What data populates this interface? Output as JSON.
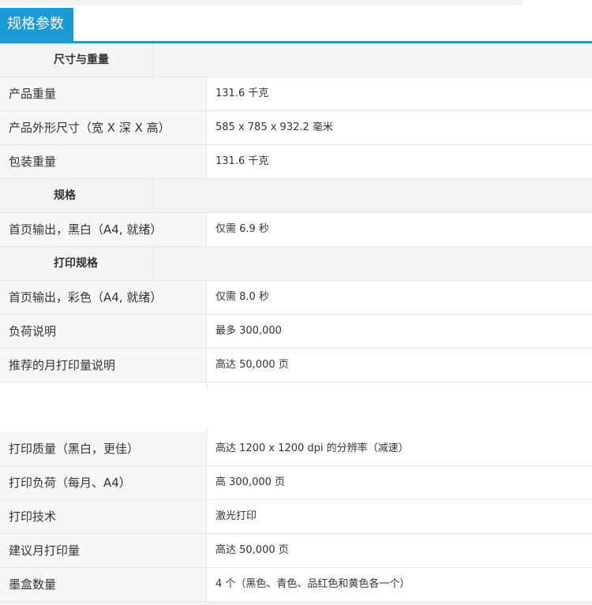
{
  "header": {
    "tab_title": "规格参数"
  },
  "sections_top": [
    {
      "kind": "section",
      "label": "尺寸与重量"
    },
    {
      "kind": "row",
      "label": "产品重量",
      "value": "131.6 千克"
    },
    {
      "kind": "row",
      "label": "产品外形尺寸（宽 X 深 X 高）",
      "value": "585 x 785 x 932.2 毫米"
    },
    {
      "kind": "row",
      "label": "包装重量",
      "value": "131.6 千克"
    },
    {
      "kind": "section",
      "label": "规格"
    },
    {
      "kind": "row",
      "label": "首页输出，黑白（A4, 就绪）",
      "value": "仅需 6.9 秒"
    },
    {
      "kind": "section",
      "label": "打印规格"
    },
    {
      "kind": "row",
      "label": "首页输出，彩色（A4, 就绪）",
      "value": "仅需 8.0 秒"
    },
    {
      "kind": "row",
      "label": "负荷说明",
      "value": "最多 300,000"
    },
    {
      "kind": "row",
      "label": "推荐的月打印量说明",
      "value": "高达 50,000 页"
    }
  ],
  "sections_bottom": [
    {
      "kind": "row",
      "label": "打印质量（黑白，更佳）",
      "value": "高达 1200 x 1200 dpi 的分辨率（减速）"
    },
    {
      "kind": "row",
      "label": "打印负荷（每月、A4）",
      "value": "高 300,000 页"
    },
    {
      "kind": "row",
      "label": "打印技术",
      "value": "激光打印"
    },
    {
      "kind": "row",
      "label": "建议月打印量",
      "value": "高达 50,000 页"
    },
    {
      "kind": "row",
      "label": "墨盒数量",
      "value": "4 个（黑色、青色、品红色和黄色各一个）"
    }
  ],
  "colors": {
    "accent": "#1a9ad6",
    "section_bg": "#f4f4f4",
    "border": "#e6e6e6"
  }
}
